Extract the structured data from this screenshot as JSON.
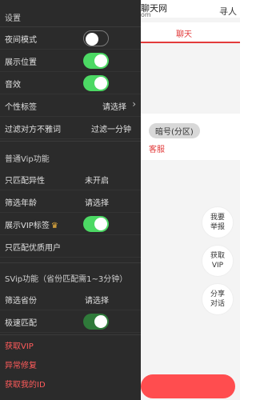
{
  "background": {
    "title_partial": "聊天网",
    "title_sub_partial": "om",
    "right_partial": "寻人",
    "active_tab": "聊天",
    "pill": "暗号(分区)",
    "link_partial": "客服",
    "floating": [
      {
        "line1": "我要",
        "line2": "举报"
      },
      {
        "line1": "获取",
        "line2": "VIP"
      },
      {
        "line1": "分享",
        "line2": "对话"
      }
    ]
  },
  "drawer": {
    "settings_title": "设置",
    "settings_rows": [
      {
        "label": "夜间模式",
        "type": "toggle",
        "state": "off"
      },
      {
        "label": "展示位置",
        "type": "toggle",
        "state": "on"
      },
      {
        "label": "音效",
        "type": "toggle",
        "state": "on"
      },
      {
        "label": "个性标签",
        "type": "select",
        "value": "请选择"
      },
      {
        "label": "过滤对方不雅词",
        "type": "select",
        "value": "过滤一分钟"
      }
    ],
    "vip_title": "普通Vip功能",
    "vip_rows": [
      {
        "label": "只匹配异性",
        "type": "value",
        "value": "未开启"
      },
      {
        "label": "筛选年龄",
        "type": "value",
        "value": "请选择"
      },
      {
        "label": "展示VIP标签",
        "type": "toggle",
        "state": "on",
        "icon": "crown-icon"
      },
      {
        "label": "只匹配优质用户",
        "type": "plain"
      }
    ],
    "svip_title": "SVip功能（省份匹配需1~3分钟）",
    "svip_rows": [
      {
        "label": "筛选省份",
        "type": "value",
        "value": "请选择"
      },
      {
        "label": "极速匹配",
        "type": "toggle",
        "state": "on"
      }
    ],
    "links": [
      "获取VIP",
      "异常修复",
      "获取我的ID"
    ],
    "accent_red": "#ff5b5b",
    "toggle_green": "#4cd964"
  }
}
